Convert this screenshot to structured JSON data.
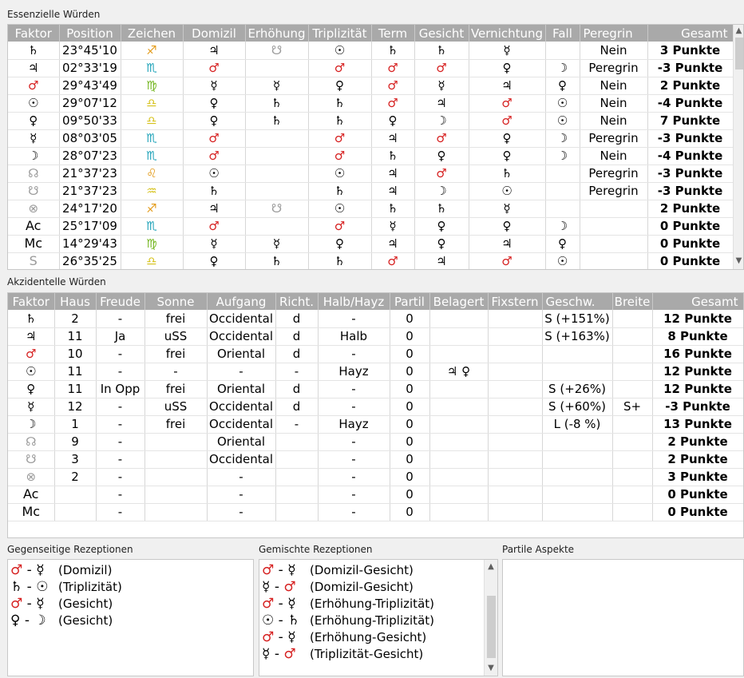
{
  "essential": {
    "title": "Essenzielle Würden",
    "headers": [
      "Faktor",
      "Position",
      "Zeichen",
      "Domizil",
      "Erhöhung",
      "Triplizität",
      "Term",
      "Gesicht",
      "Vernichtung",
      "Fall",
      "Peregrin",
      "Gesamt"
    ],
    "rows": [
      {
        "factor": {
          "g": "♄",
          "c": "blk"
        },
        "pos": "23°45'10",
        "sign": {
          "g": "♐",
          "c": "orange"
        },
        "dom": {
          "g": "♃",
          "c": "blk"
        },
        "exalt": {
          "g": "☋",
          "c": "gray"
        },
        "trip": {
          "g": "☉",
          "c": "blk"
        },
        "term": {
          "g": "♄",
          "c": "blk"
        },
        "face": {
          "g": "♄",
          "c": "blk"
        },
        "detr": {
          "g": "☿",
          "c": "blk"
        },
        "fall": {
          "g": "",
          "c": "blk"
        },
        "pereg": "Nein",
        "total": "3 Punkte"
      },
      {
        "factor": {
          "g": "♃",
          "c": "blk"
        },
        "pos": "02°33'19",
        "sign": {
          "g": "♏",
          "c": "teal"
        },
        "dom": {
          "g": "♂",
          "c": "red"
        },
        "exalt": {
          "g": "",
          "c": "blk"
        },
        "trip": {
          "g": "♂",
          "c": "red"
        },
        "term": {
          "g": "♂",
          "c": "red"
        },
        "face": {
          "g": "♂",
          "c": "red"
        },
        "detr": {
          "g": "♀",
          "c": "blk"
        },
        "fall": {
          "g": "☽",
          "c": "blk"
        },
        "pereg": "Peregrin",
        "total": "-3 Punkte"
      },
      {
        "factor": {
          "g": "♂",
          "c": "red"
        },
        "pos": "29°43'49",
        "sign": {
          "g": "♍",
          "c": "green"
        },
        "dom": {
          "g": "☿",
          "c": "blk"
        },
        "exalt": {
          "g": "☿",
          "c": "blk"
        },
        "trip": {
          "g": "♀",
          "c": "blk"
        },
        "term": {
          "g": "♂",
          "c": "red"
        },
        "face": {
          "g": "☿",
          "c": "blk"
        },
        "detr": {
          "g": "♃",
          "c": "blk"
        },
        "fall": {
          "g": "♀",
          "c": "blk"
        },
        "pereg": "Nein",
        "total": "2 Punkte"
      },
      {
        "factor": {
          "g": "☉",
          "c": "blk"
        },
        "pos": "29°07'12",
        "sign": {
          "g": "♎",
          "c": "yellow"
        },
        "dom": {
          "g": "♀",
          "c": "blk"
        },
        "exalt": {
          "g": "♄",
          "c": "blk"
        },
        "trip": {
          "g": "♄",
          "c": "blk"
        },
        "term": {
          "g": "♂",
          "c": "red"
        },
        "face": {
          "g": "♃",
          "c": "blk"
        },
        "detr": {
          "g": "♂",
          "c": "red"
        },
        "fall": {
          "g": "☉",
          "c": "blk"
        },
        "pereg": "Nein",
        "total": "-4 Punkte"
      },
      {
        "factor": {
          "g": "♀",
          "c": "blk"
        },
        "pos": "09°50'33",
        "sign": {
          "g": "♎",
          "c": "yellow"
        },
        "dom": {
          "g": "♀",
          "c": "blk"
        },
        "exalt": {
          "g": "♄",
          "c": "blk"
        },
        "trip": {
          "g": "♄",
          "c": "blk"
        },
        "term": {
          "g": "♀",
          "c": "blk"
        },
        "face": {
          "g": "☽",
          "c": "blk"
        },
        "detr": {
          "g": "♂",
          "c": "red"
        },
        "fall": {
          "g": "☉",
          "c": "blk"
        },
        "pereg": "Nein",
        "total": "7 Punkte"
      },
      {
        "factor": {
          "g": "☿",
          "c": "blk"
        },
        "pos": "08°03'05",
        "sign": {
          "g": "♏",
          "c": "teal"
        },
        "dom": {
          "g": "♂",
          "c": "red"
        },
        "exalt": {
          "g": "",
          "c": "blk"
        },
        "trip": {
          "g": "♂",
          "c": "red"
        },
        "term": {
          "g": "♃",
          "c": "blk"
        },
        "face": {
          "g": "♂",
          "c": "red"
        },
        "detr": {
          "g": "♀",
          "c": "blk"
        },
        "fall": {
          "g": "☽",
          "c": "blk"
        },
        "pereg": "Peregrin",
        "total": "-3 Punkte"
      },
      {
        "factor": {
          "g": "☽",
          "c": "blk"
        },
        "pos": "28°07'23",
        "sign": {
          "g": "♏",
          "c": "teal"
        },
        "dom": {
          "g": "♂",
          "c": "red"
        },
        "exalt": {
          "g": "",
          "c": "blk"
        },
        "trip": {
          "g": "♂",
          "c": "red"
        },
        "term": {
          "g": "♄",
          "c": "blk"
        },
        "face": {
          "g": "♀",
          "c": "blk"
        },
        "detr": {
          "g": "♀",
          "c": "blk"
        },
        "fall": {
          "g": "☽",
          "c": "blk"
        },
        "pereg": "Nein",
        "total": "-4 Punkte"
      },
      {
        "factor": {
          "g": "☊",
          "c": "gray"
        },
        "pos": "21°37'23",
        "sign": {
          "g": "♌",
          "c": "orange"
        },
        "dom": {
          "g": "☉",
          "c": "blk"
        },
        "exalt": {
          "g": "",
          "c": "blk"
        },
        "trip": {
          "g": "☉",
          "c": "blk"
        },
        "term": {
          "g": "♃",
          "c": "blk"
        },
        "face": {
          "g": "♂",
          "c": "red"
        },
        "detr": {
          "g": "♄",
          "c": "blk"
        },
        "fall": {
          "g": "",
          "c": "blk"
        },
        "pereg": "Peregrin",
        "total": "-3 Punkte"
      },
      {
        "factor": {
          "g": "☋",
          "c": "gray"
        },
        "pos": "21°37'23",
        "sign": {
          "g": "♒",
          "c": "yellow"
        },
        "dom": {
          "g": "♄",
          "c": "blk"
        },
        "exalt": {
          "g": "",
          "c": "blk"
        },
        "trip": {
          "g": "♄",
          "c": "blk"
        },
        "term": {
          "g": "♃",
          "c": "blk"
        },
        "face": {
          "g": "☽",
          "c": "blk"
        },
        "detr": {
          "g": "☉",
          "c": "blk"
        },
        "fall": {
          "g": "",
          "c": "blk"
        },
        "pereg": "Peregrin",
        "total": "-3 Punkte"
      },
      {
        "factor": {
          "g": "⊗",
          "c": "gray"
        },
        "pos": "24°17'20",
        "sign": {
          "g": "♐",
          "c": "orange"
        },
        "dom": {
          "g": "♃",
          "c": "blk"
        },
        "exalt": {
          "g": "☋",
          "c": "gray"
        },
        "trip": {
          "g": "☉",
          "c": "blk"
        },
        "term": {
          "g": "♄",
          "c": "blk"
        },
        "face": {
          "g": "♄",
          "c": "blk"
        },
        "detr": {
          "g": "☿",
          "c": "blk"
        },
        "fall": {
          "g": "",
          "c": "blk"
        },
        "pereg": "",
        "total": "2 Punkte"
      },
      {
        "factor": {
          "g": "Ac",
          "c": "blk"
        },
        "pos": "25°17'09",
        "sign": {
          "g": "♏",
          "c": "teal"
        },
        "dom": {
          "g": "♂",
          "c": "red"
        },
        "exalt": {
          "g": "",
          "c": "blk"
        },
        "trip": {
          "g": "♂",
          "c": "red"
        },
        "term": {
          "g": "☿",
          "c": "blk"
        },
        "face": {
          "g": "♀",
          "c": "blk"
        },
        "detr": {
          "g": "♀",
          "c": "blk"
        },
        "fall": {
          "g": "☽",
          "c": "blk"
        },
        "pereg": "",
        "total": "0 Punkte"
      },
      {
        "factor": {
          "g": "Mc",
          "c": "blk"
        },
        "pos": "14°29'43",
        "sign": {
          "g": "♍",
          "c": "green"
        },
        "dom": {
          "g": "☿",
          "c": "blk"
        },
        "exalt": {
          "g": "☿",
          "c": "blk"
        },
        "trip": {
          "g": "♀",
          "c": "blk"
        },
        "term": {
          "g": "♃",
          "c": "blk"
        },
        "face": {
          "g": "♀",
          "c": "blk"
        },
        "detr": {
          "g": "♃",
          "c": "blk"
        },
        "fall": {
          "g": "♀",
          "c": "blk"
        },
        "pereg": "",
        "total": "0 Punkte"
      },
      {
        "factor": {
          "g": "S",
          "c": "gray"
        },
        "pos": "26°35'25",
        "sign": {
          "g": "♎",
          "c": "yellow"
        },
        "dom": {
          "g": "♀",
          "c": "blk"
        },
        "exalt": {
          "g": "♄",
          "c": "blk"
        },
        "trip": {
          "g": "♄",
          "c": "blk"
        },
        "term": {
          "g": "♂",
          "c": "red"
        },
        "face": {
          "g": "♃",
          "c": "blk"
        },
        "detr": {
          "g": "♂",
          "c": "red"
        },
        "fall": {
          "g": "☉",
          "c": "blk"
        },
        "pereg": "",
        "total": "0 Punkte"
      }
    ]
  },
  "accidental": {
    "title": "Akzidentelle Würden",
    "headers": [
      "Faktor",
      "Haus",
      "Freude",
      "Sonne",
      "Aufgang",
      "Richt.",
      "Halb/Hayz",
      "Partil",
      "Belagert",
      "Fixstern",
      "Geschw.",
      "Breite",
      "Gesamt"
    ],
    "rows": [
      {
        "factor": {
          "g": "♄",
          "c": "blk"
        },
        "haus": "2",
        "freude": "-",
        "sonne": "frei",
        "aufgang": "Occidental",
        "richt": "d",
        "halb": "-",
        "partil": "0",
        "belagert": {
          "g": "",
          "c": "blk"
        },
        "fix": "",
        "speed": "S (+151%)",
        "breite": "",
        "total": "12 Punkte"
      },
      {
        "factor": {
          "g": "♃",
          "c": "blk"
        },
        "haus": "11",
        "freude": "Ja",
        "sonne": "uSS",
        "aufgang": "Occidental",
        "richt": "d",
        "halb": "Halb",
        "partil": "0",
        "belagert": {
          "g": "",
          "c": "blk"
        },
        "fix": "",
        "speed": "S (+163%)",
        "breite": "",
        "total": "8 Punkte"
      },
      {
        "factor": {
          "g": "♂",
          "c": "red"
        },
        "haus": "10",
        "freude": "-",
        "sonne": "frei",
        "aufgang": "Oriental",
        "richt": "d",
        "halb": "-",
        "partil": "0",
        "belagert": {
          "g": "",
          "c": "blk"
        },
        "fix": "",
        "speed": "",
        "breite": "",
        "total": "16 Punkte"
      },
      {
        "factor": {
          "g": "☉",
          "c": "blk"
        },
        "haus": "11",
        "freude": "-",
        "sonne": "-",
        "aufgang": "-",
        "richt": "-",
        "halb": "Hayz",
        "partil": "0",
        "belagert": {
          "g": "♃ ♀",
          "c": "blk"
        },
        "fix": "",
        "speed": "",
        "breite": "",
        "total": "12 Punkte"
      },
      {
        "factor": {
          "g": "♀",
          "c": "blk"
        },
        "haus": "11",
        "freude": "In Opp",
        "sonne": "frei",
        "aufgang": "Oriental",
        "richt": "d",
        "halb": "-",
        "partil": "0",
        "belagert": {
          "g": "",
          "c": "blk"
        },
        "fix": "",
        "speed": "S (+26%)",
        "breite": "",
        "total": "12 Punkte"
      },
      {
        "factor": {
          "g": "☿",
          "c": "blk"
        },
        "haus": "12",
        "freude": "-",
        "sonne": "uSS",
        "aufgang": "Occidental",
        "richt": "d",
        "halb": "-",
        "partil": "0",
        "belagert": {
          "g": "",
          "c": "blk"
        },
        "fix": "",
        "speed": "S (+60%)",
        "breite": "S+",
        "total": "-3 Punkte"
      },
      {
        "factor": {
          "g": "☽",
          "c": "blk"
        },
        "haus": "1",
        "freude": "-",
        "sonne": "frei",
        "aufgang": "Occidental",
        "richt": "-",
        "halb": "Hayz",
        "partil": "0",
        "belagert": {
          "g": "",
          "c": "blk"
        },
        "fix": "",
        "speed": "L (-8 %)",
        "breite": "",
        "total": "13 Punkte"
      },
      {
        "factor": {
          "g": "☊",
          "c": "gray"
        },
        "haus": "9",
        "freude": "-",
        "sonne": "",
        "aufgang": "Oriental",
        "richt": "",
        "halb": "-",
        "partil": "0",
        "belagert": {
          "g": "",
          "c": "blk"
        },
        "fix": "",
        "speed": "",
        "breite": "",
        "total": "2 Punkte"
      },
      {
        "factor": {
          "g": "☋",
          "c": "gray"
        },
        "haus": "3",
        "freude": "-",
        "sonne": "",
        "aufgang": "Occidental",
        "richt": "",
        "halb": "-",
        "partil": "0",
        "belagert": {
          "g": "",
          "c": "blk"
        },
        "fix": "",
        "speed": "",
        "breite": "",
        "total": "2 Punkte"
      },
      {
        "factor": {
          "g": "⊗",
          "c": "gray"
        },
        "haus": "2",
        "freude": "-",
        "sonne": "",
        "aufgang": "-",
        "richt": "",
        "halb": "-",
        "partil": "0",
        "belagert": {
          "g": "",
          "c": "blk"
        },
        "fix": "",
        "speed": "",
        "breite": "",
        "total": "3 Punkte"
      },
      {
        "factor": {
          "g": "Ac",
          "c": "blk"
        },
        "haus": "",
        "freude": "-",
        "sonne": "",
        "aufgang": "-",
        "richt": "",
        "halb": "-",
        "partil": "0",
        "belagert": {
          "g": "",
          "c": "blk"
        },
        "fix": "",
        "speed": "",
        "breite": "",
        "total": "0 Punkte"
      },
      {
        "factor": {
          "g": "Mc",
          "c": "blk"
        },
        "haus": "",
        "freude": "-",
        "sonne": "",
        "aufgang": "-",
        "richt": "",
        "halb": "-",
        "partil": "0",
        "belagert": {
          "g": "",
          "c": "blk"
        },
        "fix": "",
        "speed": "",
        "breite": "",
        "total": "0 Punkte"
      }
    ]
  },
  "mutual": {
    "title": "Gegenseitige Rezeptionen",
    "items": [
      {
        "a": {
          "g": "♂",
          "c": "red"
        },
        "b": {
          "g": "☿",
          "c": "blk"
        },
        "label": "(Domizil)"
      },
      {
        "a": {
          "g": "♄",
          "c": "blk"
        },
        "b": {
          "g": "☉",
          "c": "blk"
        },
        "label": "(Triplizität)"
      },
      {
        "a": {
          "g": "♂",
          "c": "red"
        },
        "b": {
          "g": "☿",
          "c": "blk"
        },
        "label": "(Gesicht)"
      },
      {
        "a": {
          "g": "♀",
          "c": "blk"
        },
        "b": {
          "g": "☽",
          "c": "blk"
        },
        "label": "(Gesicht)"
      }
    ]
  },
  "mixed": {
    "title": "Gemischte Rezeptionen",
    "items": [
      {
        "a": {
          "g": "♂",
          "c": "red"
        },
        "b": {
          "g": "☿",
          "c": "blk"
        },
        "label": "(Domizil-Gesicht)"
      },
      {
        "a": {
          "g": "☿",
          "c": "blk"
        },
        "b": {
          "g": "♂",
          "c": "red"
        },
        "label": "(Domizil-Gesicht)"
      },
      {
        "a": {
          "g": "♂",
          "c": "red"
        },
        "b": {
          "g": "☿",
          "c": "blk"
        },
        "label": "(Erhöhung-Triplizität)"
      },
      {
        "a": {
          "g": "☉",
          "c": "blk"
        },
        "b": {
          "g": "♄",
          "c": "blk"
        },
        "label": "(Erhöhung-Triplizität)"
      },
      {
        "a": {
          "g": "♂",
          "c": "red"
        },
        "b": {
          "g": "☿",
          "c": "blk"
        },
        "label": "(Erhöhung-Gesicht)"
      },
      {
        "a": {
          "g": "☿",
          "c": "blk"
        },
        "b": {
          "g": "♂",
          "c": "red"
        },
        "label": "(Triplizität-Gesicht)"
      }
    ]
  },
  "partile": {
    "title": "Partile Aspekte",
    "items": []
  },
  "icons": {
    "scroll_up": "▲",
    "scroll_down": "▼",
    "dash": " - "
  }
}
